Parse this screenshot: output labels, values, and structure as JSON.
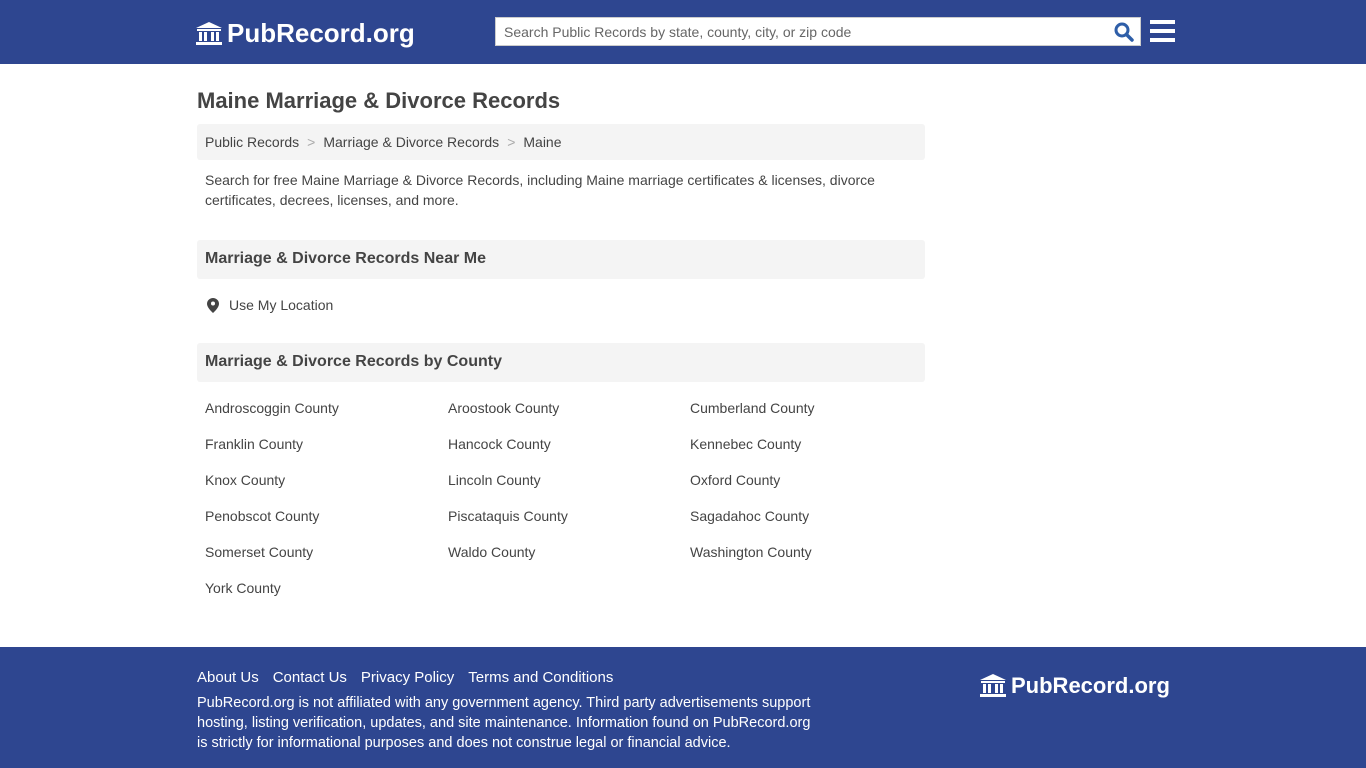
{
  "header": {
    "logo": "PubRecord.org",
    "search_placeholder": "Search Public Records by state, county, city, or zip code"
  },
  "page_title": "Maine Marriage & Divorce Records",
  "breadcrumb": [
    "Public Records",
    "Marriage & Divorce Records",
    "Maine"
  ],
  "description": "Search for free Maine Marriage & Divorce Records, including Maine marriage certificates & licenses, divorce certificates, decrees, licenses, and more.",
  "near_me": {
    "title": "Marriage & Divorce Records Near Me",
    "link": "Use My Location"
  },
  "by_county": {
    "title": "Marriage & Divorce Records by County",
    "counties": [
      "Androscoggin County",
      "Aroostook County",
      "Cumberland County",
      "Franklin County",
      "Hancock County",
      "Kennebec County",
      "Knox County",
      "Lincoln County",
      "Oxford County",
      "Penobscot County",
      "Piscataquis County",
      "Sagadahoc County",
      "Somerset County",
      "Waldo County",
      "Washington County",
      "York County"
    ]
  },
  "footer": {
    "links": [
      "About Us",
      "Contact Us",
      "Privacy Policy",
      "Terms and Conditions"
    ],
    "disclaimer": "PubRecord.org is not affiliated with any government agency. Third party advertisements support hosting, listing verification, updates, and site maintenance. Information found on PubRecord.org is strictly for informational purposes and does not construe legal or financial advice.",
    "logo": "PubRecord.org"
  },
  "colors": {
    "brand": "#2e4690",
    "search_icon": "#2e5ea8"
  }
}
